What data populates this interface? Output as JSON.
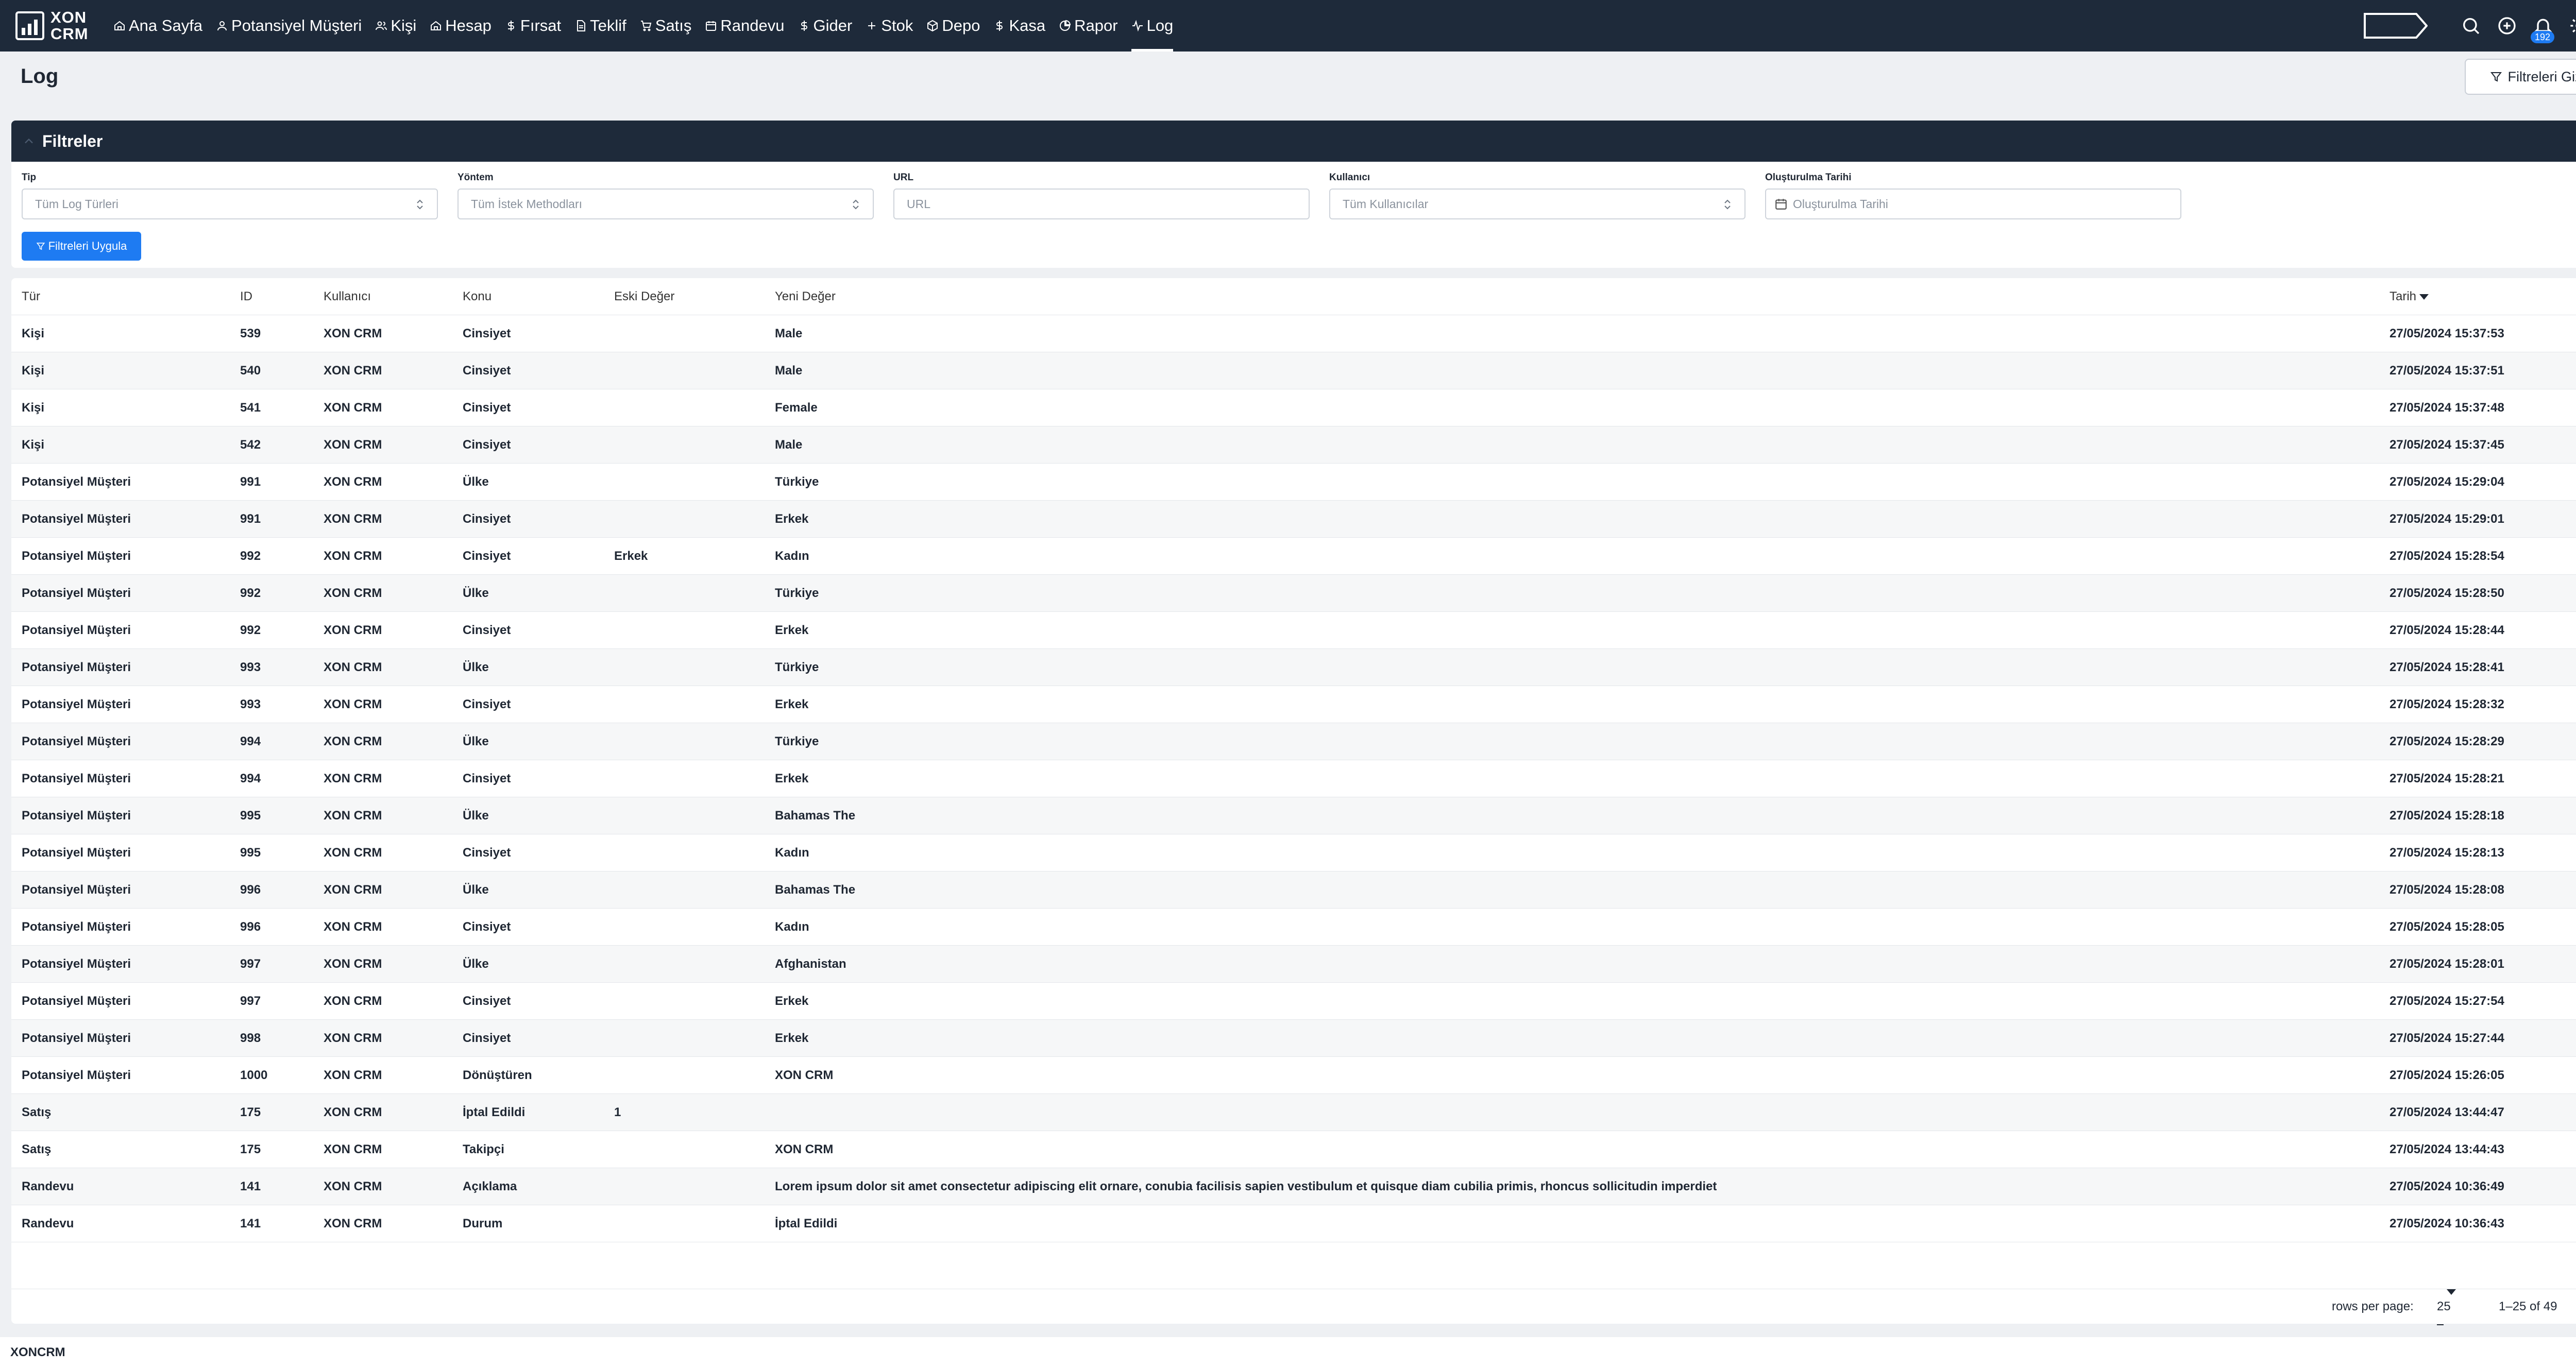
{
  "brand": {
    "line1": "XON",
    "line2": "CRM"
  },
  "nav": [
    {
      "label": "Ana Sayfa",
      "icon": "home-icon"
    },
    {
      "label": "Potansiyel Müşteri",
      "icon": "user-icon"
    },
    {
      "label": "Kişi",
      "icon": "users-icon"
    },
    {
      "label": "Hesap",
      "icon": "home-icon"
    },
    {
      "label": "Fırsat",
      "icon": "dollar-icon"
    },
    {
      "label": "Teklif",
      "icon": "document-icon"
    },
    {
      "label": "Satış",
      "icon": "cart-icon"
    },
    {
      "label": "Randevu",
      "icon": "calendar-icon"
    },
    {
      "label": "Gider",
      "icon": "dollar-icon"
    },
    {
      "label": "Stok",
      "icon": "plus-icon"
    },
    {
      "label": "Depo",
      "icon": "box-icon"
    },
    {
      "label": "Kasa",
      "icon": "dollar-icon"
    },
    {
      "label": "Rapor",
      "icon": "pie-icon"
    },
    {
      "label": "Log",
      "icon": "activity-icon",
      "active": true
    }
  ],
  "notifications": {
    "count": "192"
  },
  "page": {
    "title": "Log",
    "hide_filters_label": "Filtreleri Gizle"
  },
  "filters": {
    "title": "Filtreler",
    "type": {
      "label": "Tip",
      "value": "Tüm Log Türleri"
    },
    "method": {
      "label": "Yöntem",
      "value": "Tüm İstek Methodları"
    },
    "url": {
      "label": "URL",
      "placeholder": "URL"
    },
    "user": {
      "label": "Kullanıcı",
      "value": "Tüm Kullanıcılar"
    },
    "created": {
      "label": "Oluşturulma Tarihi",
      "placeholder": "Oluşturulma Tarihi"
    },
    "apply_label": "Filtreleri Uygula"
  },
  "table": {
    "headers": {
      "type": "Tür",
      "id": "ID",
      "user": "Kullanıcı",
      "subject": "Konu",
      "old": "Eski Değer",
      "new": "Yeni Değer",
      "date": "Tarih"
    },
    "rows": [
      {
        "type": "Kişi",
        "id": "539",
        "user": "XON CRM",
        "subject": "Cinsiyet",
        "old": "",
        "new": "Male",
        "date": "27/05/2024 15:37:53"
      },
      {
        "type": "Kişi",
        "id": "540",
        "user": "XON CRM",
        "subject": "Cinsiyet",
        "old": "",
        "new": "Male",
        "date": "27/05/2024 15:37:51"
      },
      {
        "type": "Kişi",
        "id": "541",
        "user": "XON CRM",
        "subject": "Cinsiyet",
        "old": "",
        "new": "Female",
        "date": "27/05/2024 15:37:48"
      },
      {
        "type": "Kişi",
        "id": "542",
        "user": "XON CRM",
        "subject": "Cinsiyet",
        "old": "",
        "new": "Male",
        "date": "27/05/2024 15:37:45"
      },
      {
        "type": "Potansiyel Müşteri",
        "id": "991",
        "user": "XON CRM",
        "subject": "Ülke",
        "old": "",
        "new": "Türkiye",
        "date": "27/05/2024 15:29:04"
      },
      {
        "type": "Potansiyel Müşteri",
        "id": "991",
        "user": "XON CRM",
        "subject": "Cinsiyet",
        "old": "",
        "new": "Erkek",
        "date": "27/05/2024 15:29:01"
      },
      {
        "type": "Potansiyel Müşteri",
        "id": "992",
        "user": "XON CRM",
        "subject": "Cinsiyet",
        "old": "Erkek",
        "new": "Kadın",
        "date": "27/05/2024 15:28:54"
      },
      {
        "type": "Potansiyel Müşteri",
        "id": "992",
        "user": "XON CRM",
        "subject": "Ülke",
        "old": "",
        "new": "Türkiye",
        "date": "27/05/2024 15:28:50"
      },
      {
        "type": "Potansiyel Müşteri",
        "id": "992",
        "user": "XON CRM",
        "subject": "Cinsiyet",
        "old": "",
        "new": "Erkek",
        "date": "27/05/2024 15:28:44"
      },
      {
        "type": "Potansiyel Müşteri",
        "id": "993",
        "user": "XON CRM",
        "subject": "Ülke",
        "old": "",
        "new": "Türkiye",
        "date": "27/05/2024 15:28:41"
      },
      {
        "type": "Potansiyel Müşteri",
        "id": "993",
        "user": "XON CRM",
        "subject": "Cinsiyet",
        "old": "",
        "new": "Erkek",
        "date": "27/05/2024 15:28:32"
      },
      {
        "type": "Potansiyel Müşteri",
        "id": "994",
        "user": "XON CRM",
        "subject": "Ülke",
        "old": "",
        "new": "Türkiye",
        "date": "27/05/2024 15:28:29"
      },
      {
        "type": "Potansiyel Müşteri",
        "id": "994",
        "user": "XON CRM",
        "subject": "Cinsiyet",
        "old": "",
        "new": "Erkek",
        "date": "27/05/2024 15:28:21"
      },
      {
        "type": "Potansiyel Müşteri",
        "id": "995",
        "user": "XON CRM",
        "subject": "Ülke",
        "old": "",
        "new": "Bahamas The",
        "date": "27/05/2024 15:28:18"
      },
      {
        "type": "Potansiyel Müşteri",
        "id": "995",
        "user": "XON CRM",
        "subject": "Cinsiyet",
        "old": "",
        "new": "Kadın",
        "date": "27/05/2024 15:28:13"
      },
      {
        "type": "Potansiyel Müşteri",
        "id": "996",
        "user": "XON CRM",
        "subject": "Ülke",
        "old": "",
        "new": "Bahamas The",
        "date": "27/05/2024 15:28:08"
      },
      {
        "type": "Potansiyel Müşteri",
        "id": "996",
        "user": "XON CRM",
        "subject": "Cinsiyet",
        "old": "",
        "new": "Kadın",
        "date": "27/05/2024 15:28:05"
      },
      {
        "type": "Potansiyel Müşteri",
        "id": "997",
        "user": "XON CRM",
        "subject": "Ülke",
        "old": "",
        "new": "Afghanistan",
        "date": "27/05/2024 15:28:01"
      },
      {
        "type": "Potansiyel Müşteri",
        "id": "997",
        "user": "XON CRM",
        "subject": "Cinsiyet",
        "old": "",
        "new": "Erkek",
        "date": "27/05/2024 15:27:54"
      },
      {
        "type": "Potansiyel Müşteri",
        "id": "998",
        "user": "XON CRM",
        "subject": "Cinsiyet",
        "old": "",
        "new": "Erkek",
        "date": "27/05/2024 15:27:44"
      },
      {
        "type": "Potansiyel Müşteri",
        "id": "1000",
        "user": "XON CRM",
        "subject": "Dönüştüren",
        "old": "",
        "new": "XON CRM",
        "date": "27/05/2024 15:26:05"
      },
      {
        "type": "Satış",
        "id": "175",
        "user": "XON CRM",
        "subject": "İptal Edildi",
        "old": "1",
        "new": "",
        "date": "27/05/2024 13:44:47"
      },
      {
        "type": "Satış",
        "id": "175",
        "user": "XON CRM",
        "subject": "Takipçi",
        "old": "",
        "new": "XON CRM",
        "date": "27/05/2024 13:44:43"
      },
      {
        "type": "Randevu",
        "id": "141",
        "user": "XON CRM",
        "subject": "Açıklama",
        "old": "",
        "new": "Lorem ipsum dolor sit amet consectetur adipiscing elit ornare, conubia facilisis sapien vestibulum et quisque diam cubilia primis, rhoncus sollicitudin imperdiet",
        "date": "27/05/2024 10:36:49"
      },
      {
        "type": "Randevu",
        "id": "141",
        "user": "XON CRM",
        "subject": "Durum",
        "old": "",
        "new": "İptal Edildi",
        "date": "27/05/2024 10:36:43"
      }
    ]
  },
  "pagination": {
    "rows_per_page_label": "rows per page:",
    "rows_per_page": "25",
    "range": "1–25 of 49"
  },
  "footer": {
    "text": "XONCRM"
  },
  "colors": {
    "topbar": "#1e2a3a",
    "accent": "#1e7bf2",
    "background": "#eef0f3"
  }
}
